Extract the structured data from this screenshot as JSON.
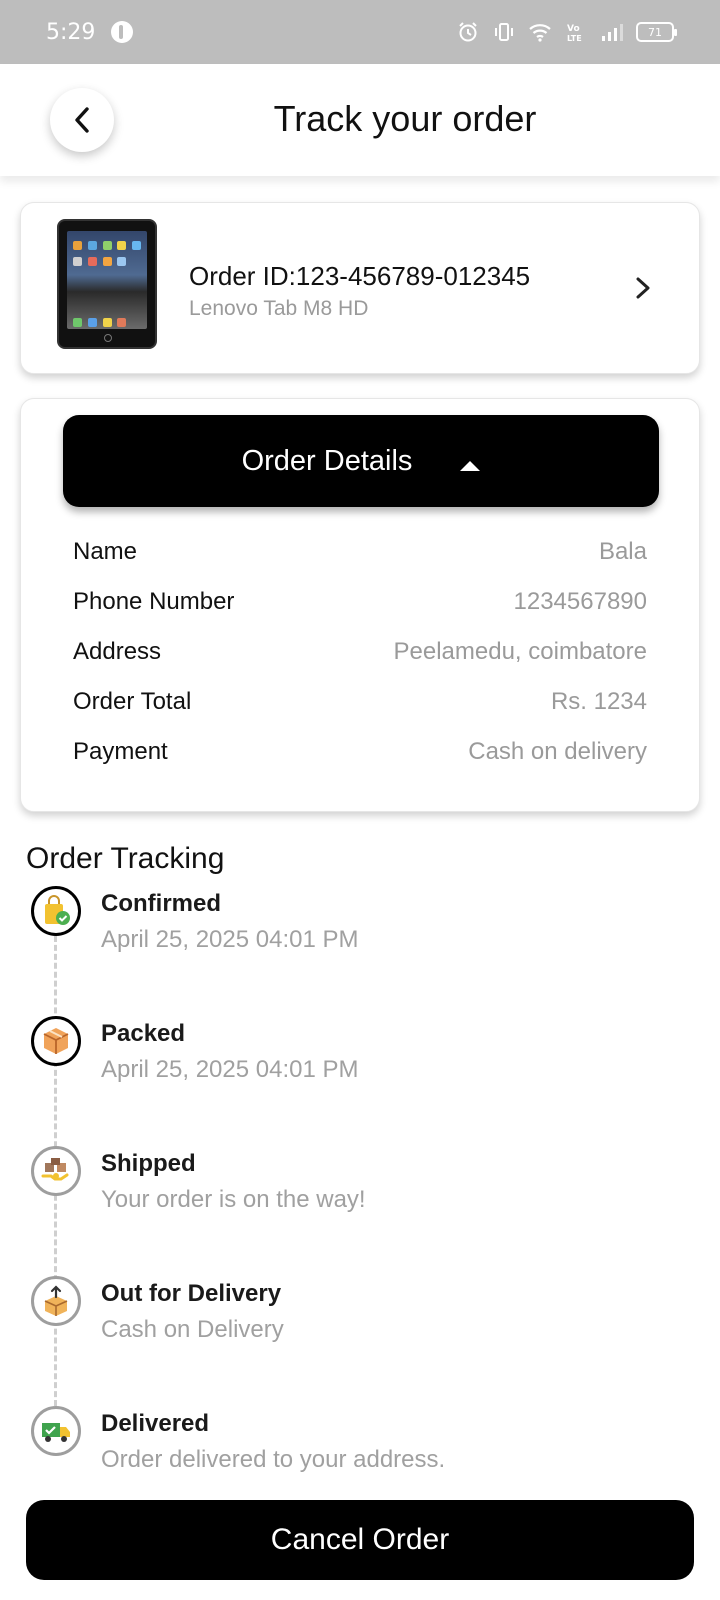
{
  "status_bar": {
    "time": "5:29",
    "battery": "71",
    "icons": [
      "alarm-icon",
      "vibrate-icon",
      "wifi-icon",
      "volte-icon",
      "signal-icon",
      "battery-icon"
    ]
  },
  "header": {
    "title": "Track your order",
    "back_icon": "chevron-left-icon"
  },
  "product": {
    "order_id": "Order ID:123-456789-012345",
    "name": "Lenovo Tab M8 HD",
    "image": "tablet-image"
  },
  "order_details": {
    "toggle_label": "Order Details",
    "rows": [
      {
        "label": "Name",
        "value": "Bala"
      },
      {
        "label": "Phone Number",
        "value": "1234567890"
      },
      {
        "label": "Address",
        "value": "Peelamedu, coimbatore"
      },
      {
        "label": "Order Total",
        "value": "Rs. 1234"
      },
      {
        "label": "Payment",
        "value": "Cash on delivery"
      }
    ]
  },
  "tracking": {
    "title": "Order Tracking",
    "steps": [
      {
        "title": "Confirmed",
        "subtitle": "April 25, 2025 04:01 PM",
        "status": "done",
        "icon": "shopping-bag-check-icon"
      },
      {
        "title": "Packed",
        "subtitle": "April 25, 2025 04:01 PM",
        "status": "done",
        "icon": "package-box-icon"
      },
      {
        "title": "Shipped",
        "subtitle": "Your order is on the way!",
        "status": "pending",
        "icon": "boxes-handover-icon"
      },
      {
        "title": "Out for Delivery",
        "subtitle": "Cash on Delivery",
        "status": "pending",
        "icon": "box-up-arrow-icon"
      },
      {
        "title": "Delivered",
        "subtitle": "Order delivered to your address.",
        "status": "pending",
        "icon": "delivery-truck-check-icon"
      }
    ]
  },
  "actions": {
    "cancel_label": "Cancel Order"
  },
  "colors": {
    "primary": "#000000",
    "muted_text": "#9a9a9a",
    "status_bar": "#bdbdbd"
  }
}
